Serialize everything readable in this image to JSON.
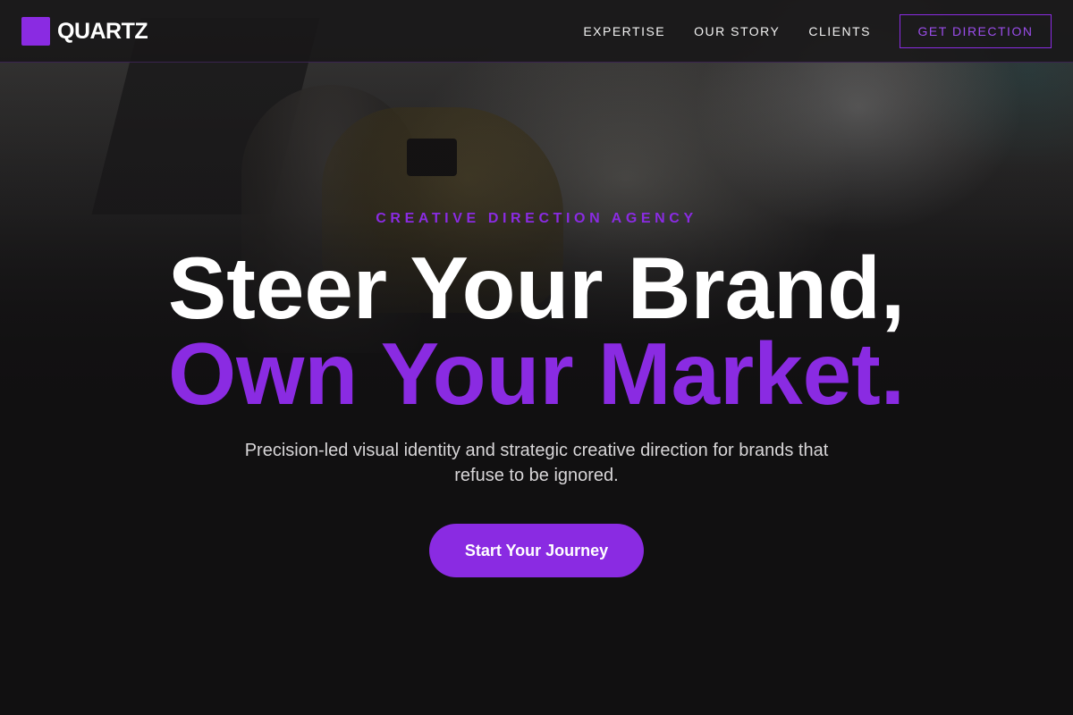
{
  "brand": {
    "name": "QUARTZ",
    "accent_color": "#8a2be2"
  },
  "nav": {
    "links": [
      {
        "label": "EXPERTISE"
      },
      {
        "label": "OUR STORY"
      },
      {
        "label": "CLIENTS"
      }
    ],
    "cta_label": "GET DIRECTION"
  },
  "hero": {
    "eyebrow": "CREATIVE DIRECTION AGENCY",
    "headline_line1": "Steer Your Brand,",
    "headline_line2": "Own Your Market.",
    "subtext": "Precision-led visual identity and strategic creative direction for brands that refuse to be ignored.",
    "cta_label": "Start Your Journey"
  }
}
